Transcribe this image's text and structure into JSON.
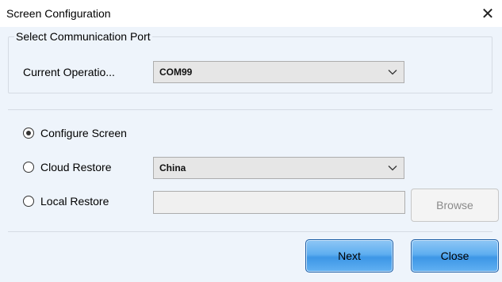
{
  "window": {
    "title": "Screen Configuration",
    "close_glyph": "✕"
  },
  "port_group": {
    "legend": "Select Communication Port",
    "current_operation_label": "Current Operatio...",
    "current_operation_value": "COM99"
  },
  "options": {
    "configure_screen_label": "Configure Screen",
    "configure_screen_checked": true,
    "cloud_restore_label": "Cloud Restore",
    "cloud_restore_checked": false,
    "cloud_region_value": "China",
    "local_restore_label": "Local Restore",
    "local_restore_checked": false,
    "local_path_value": "",
    "browse_label": "Browse"
  },
  "footer": {
    "next_label": "Next",
    "close_label": "Close"
  },
  "icons": {
    "close": "close-icon",
    "dropdown": "chevron-down-icon"
  }
}
